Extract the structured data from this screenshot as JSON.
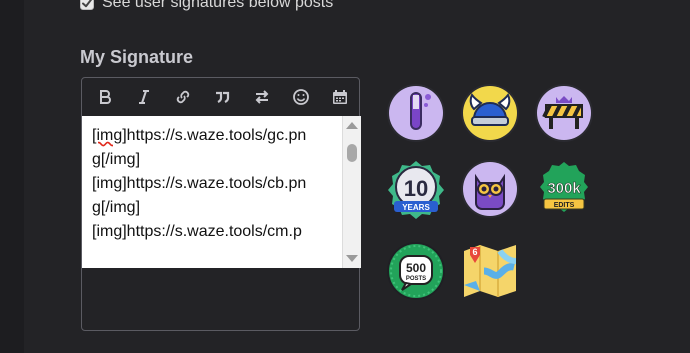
{
  "settings": {
    "show_signatures_label": "See user signatures below posts",
    "show_signatures_checked": true
  },
  "signature": {
    "title": "My Signature",
    "toolbar": [
      "bold-icon",
      "italic-icon",
      "link-icon",
      "quote-icon",
      "swap-icon",
      "emoji-icon",
      "calendar-icon"
    ],
    "lines": [
      {
        "pre": "",
        "bad": "[img]",
        "post": "https://s.waze.tools/gc.pn"
      },
      {
        "pre": "g[/img]",
        "bad": "",
        "post": ""
      },
      {
        "pre": "[img]https://s.waze.tools/cb.pn",
        "bad": "",
        "post": ""
      },
      {
        "pre": "g[/img]",
        "bad": "",
        "post": ""
      },
      {
        "pre": "[img]https://s.waze.tools/cm.p",
        "bad": "",
        "post": ""
      }
    ]
  },
  "badges": {
    "items": [
      {
        "name": "test-tube-badge-icon",
        "colors": [
          "#c9b4ef",
          "#8a5bd6"
        ]
      },
      {
        "name": "viking-helmet-badge-icon",
        "colors": [
          "#f0d94a",
          "#2a5fd0"
        ]
      },
      {
        "name": "roadblock-crown-badge-icon",
        "colors": [
          "#c9b4ef",
          "#f5c542"
        ]
      },
      {
        "name": "ten-years-badge-icon",
        "text": "10",
        "subtext": "YEARS",
        "colors": [
          "#3fb98a",
          "#2a5fd0"
        ]
      },
      {
        "name": "owl-badge-icon",
        "colors": [
          "#c9b4ef",
          "#7a4bc4"
        ]
      },
      {
        "name": "300k-edits-badge-icon",
        "text": "300k",
        "subtext": "EDITS",
        "colors": [
          "#22a35a",
          "#f5c542"
        ]
      },
      {
        "name": "500-posts-badge-icon",
        "text": "500",
        "subtext": "POSTS",
        "colors": [
          "#22a35a",
          "#ffffff"
        ]
      },
      {
        "name": "map-6-badge-icon",
        "text": "6",
        "colors": [
          "#f5d56a",
          "#5ab0e8"
        ]
      }
    ]
  }
}
